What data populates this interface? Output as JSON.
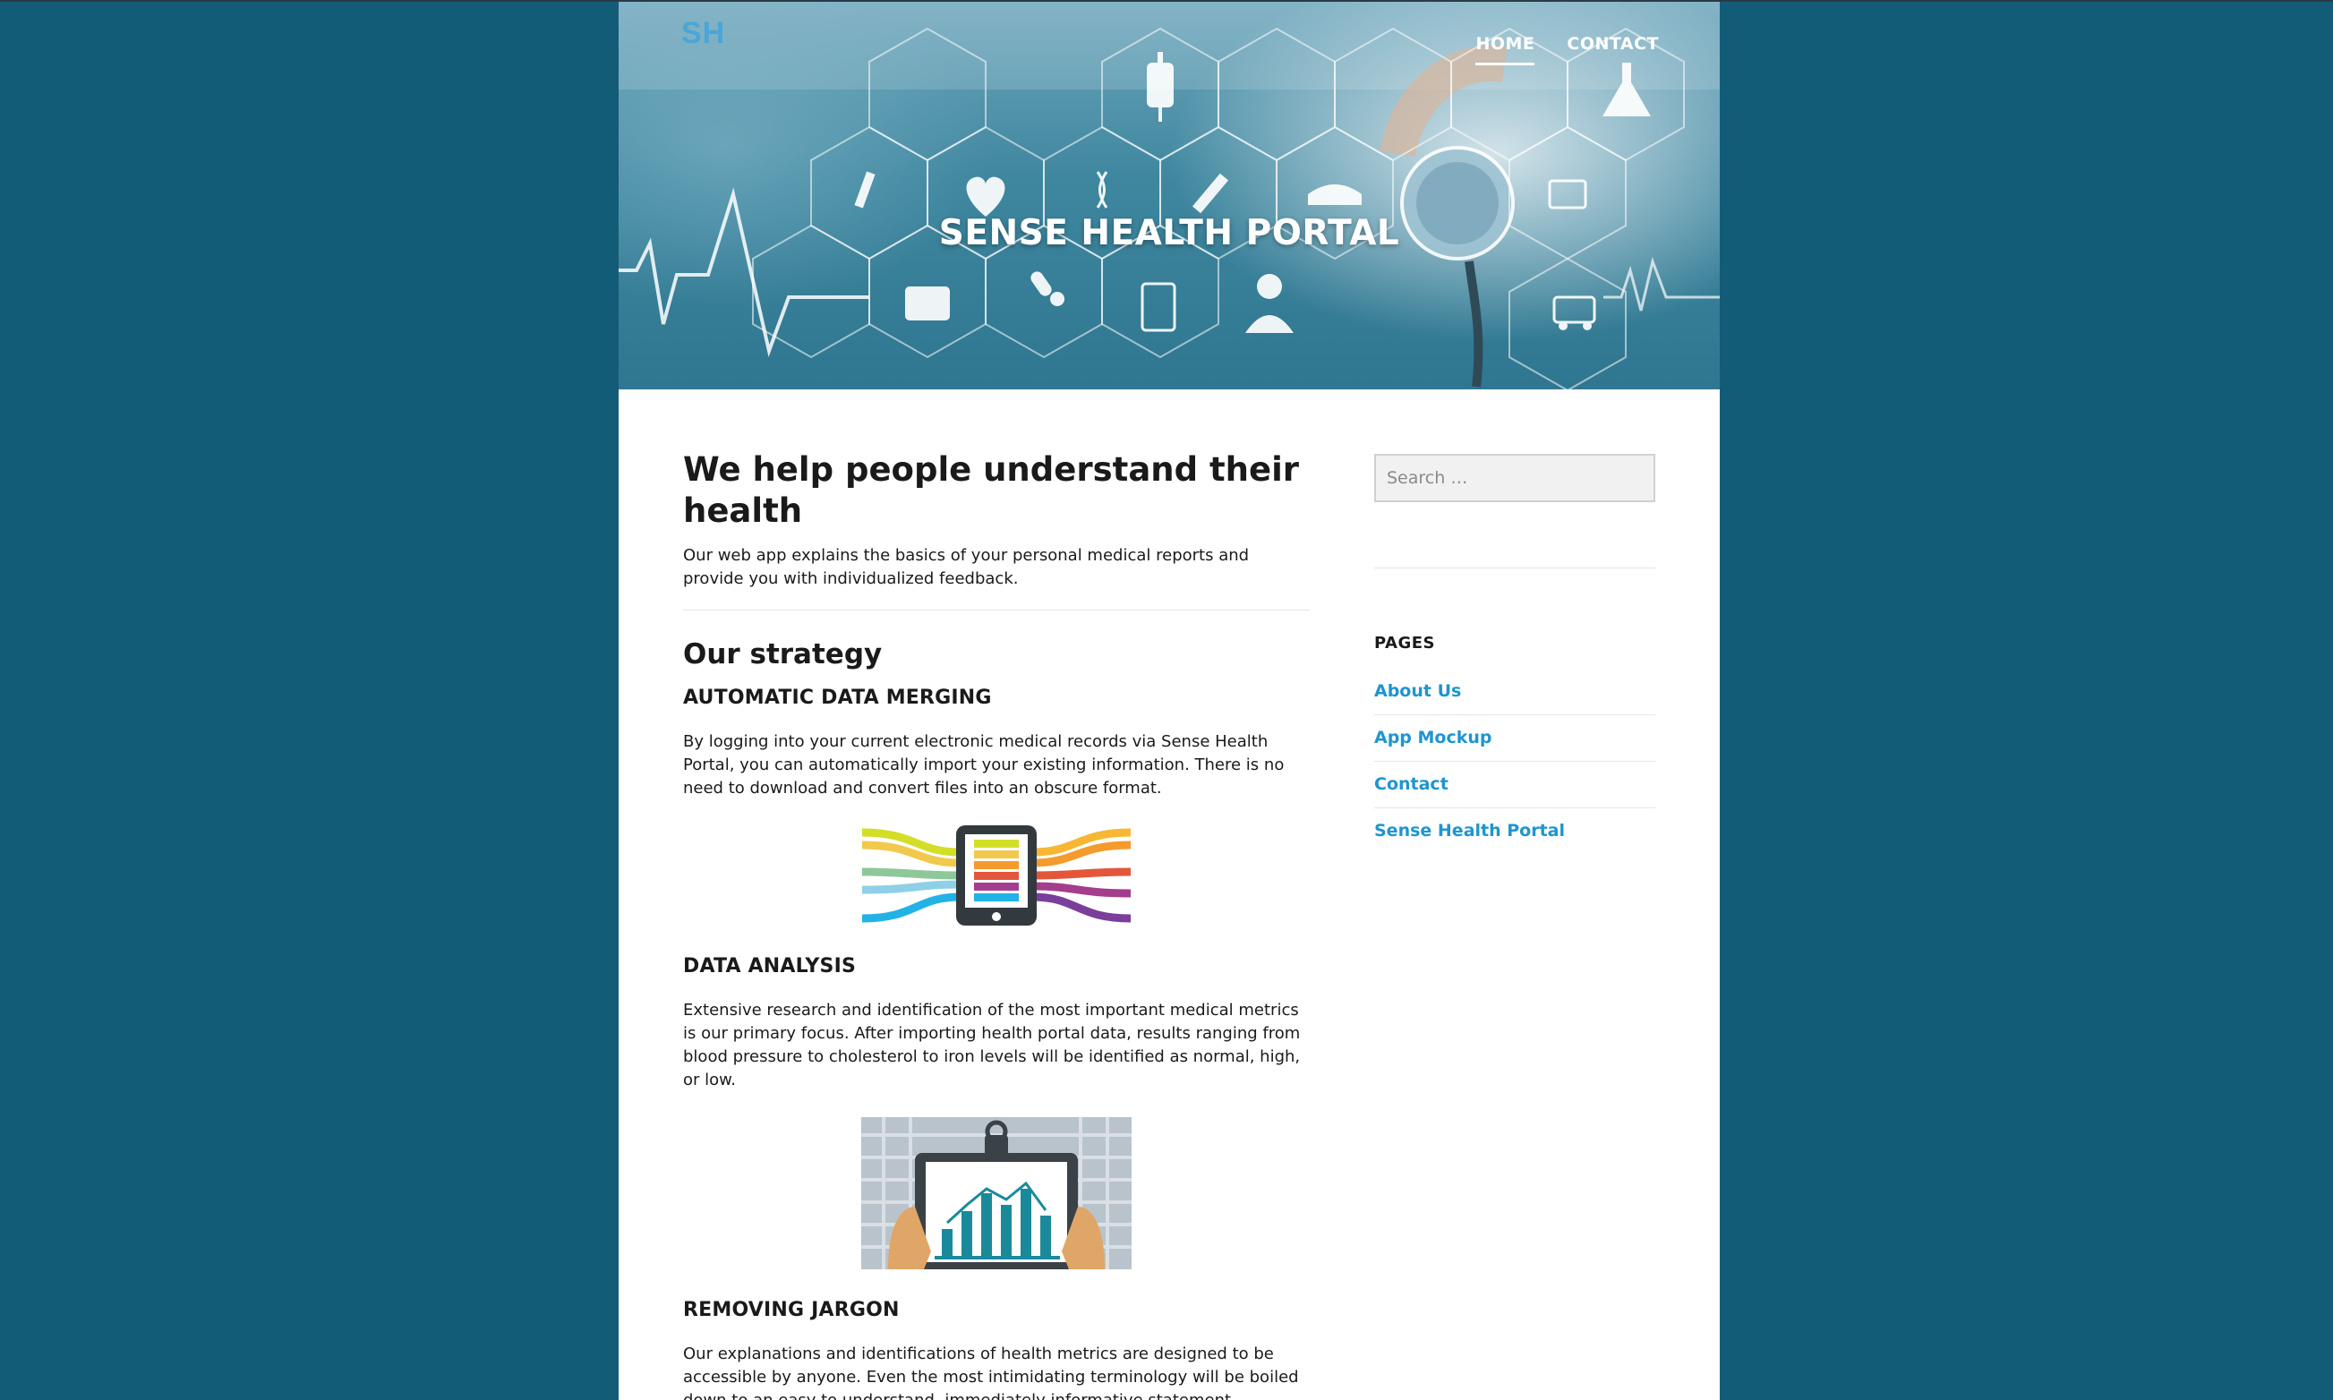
{
  "header": {
    "logo_text": "SH",
    "site_title": "SENSE HEALTH PORTAL",
    "nav": [
      {
        "label": "HOME",
        "active": true
      },
      {
        "label": "CONTACT",
        "active": false
      }
    ]
  },
  "main": {
    "headline": "We help people understand their health",
    "intro": "Our web app explains the basics of your personal medical reports and provide you with individualized feedback.",
    "strategy_title": "Our strategy",
    "sections": [
      {
        "heading": "AUTOMATIC DATA MERGING",
        "body": "By logging into your current electronic medical records via Sense Health Portal, you can automatically import your existing information. There is no need to download and convert files into an obscure format.",
        "illustration": "tablet-data-streams"
      },
      {
        "heading": "DATA ANALYSIS",
        "body": "Extensive research and identification of the most important medical metrics is our primary focus. After importing health portal data, results ranging from blood pressure to cholesterol to iron levels will be identified as normal, high, or low.",
        "illustration": "clipboard-bar-chart"
      },
      {
        "heading": "REMOVING JARGON",
        "body": "Our explanations and identifications of health metrics are designed to be accessible by anyone. Even the most intimidating terminology will be boiled down to an easy to understand, immediately informative statement."
      }
    ]
  },
  "sidebar": {
    "search_placeholder": "Search …",
    "widget_title": "PAGES",
    "pages": [
      {
        "label": "About Us"
      },
      {
        "label": "App Mockup"
      },
      {
        "label": "Contact"
      },
      {
        "label": "Sense Health Portal"
      }
    ]
  },
  "colors": {
    "background": "#135c78",
    "link": "#1e95d0",
    "logo": "#4aa6d8"
  },
  "icons": [
    "iv-bag-icon",
    "flask-icon",
    "dropper-icon",
    "heart-pulse-icon",
    "dna-icon",
    "syringe-icon",
    "nurse-cap-icon",
    "stethoscope-icon",
    "monitor-pulse-icon",
    "first-aid-kit-icon",
    "pills-icon",
    "clipboard-icon",
    "doctor-icon",
    "ambulance-icon"
  ]
}
